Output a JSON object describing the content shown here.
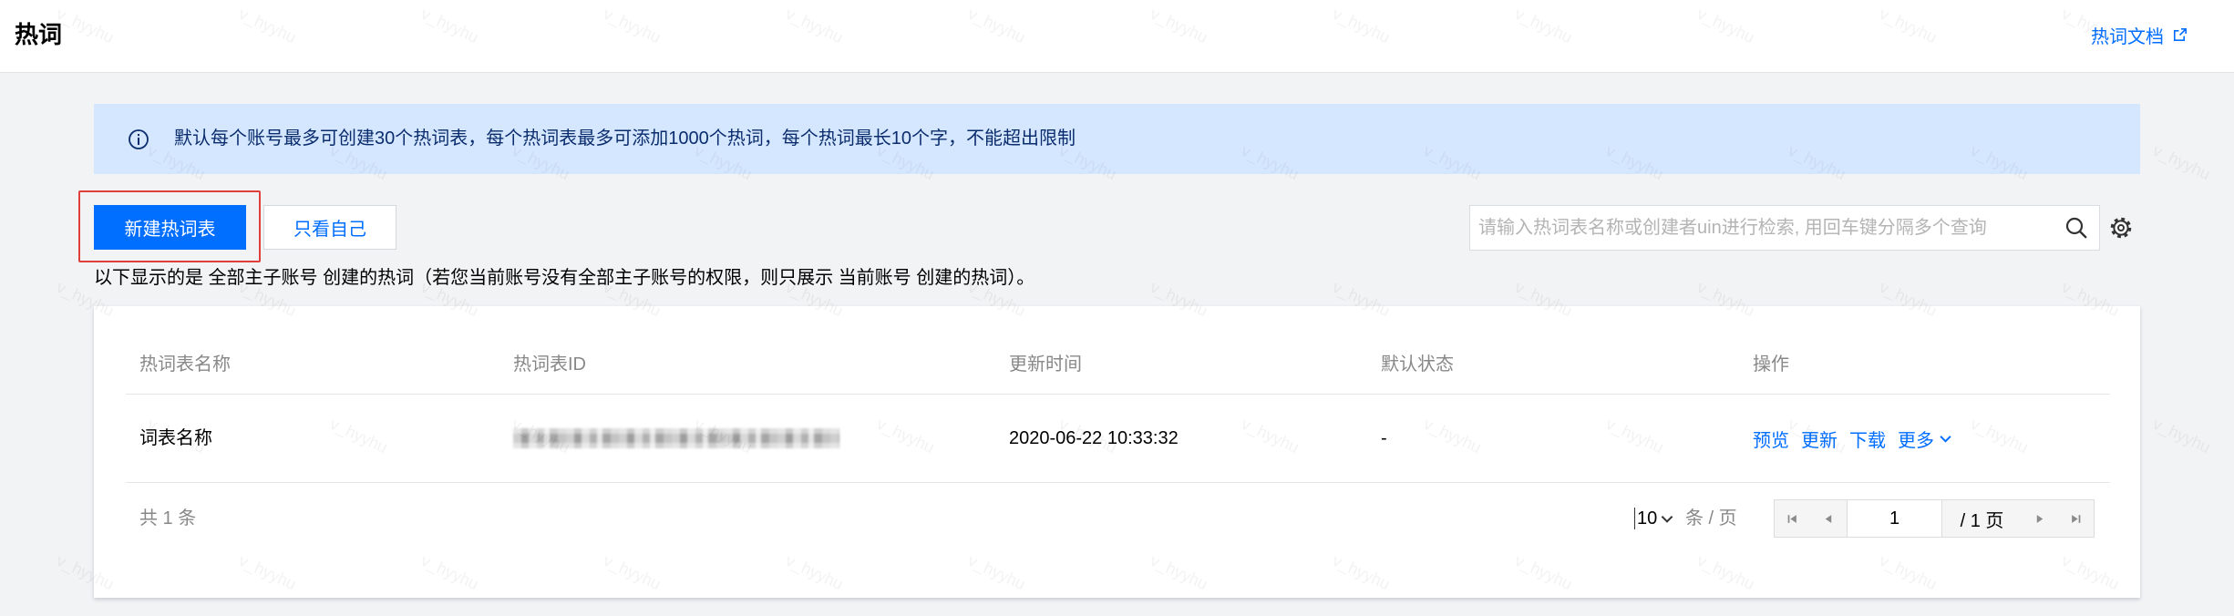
{
  "header": {
    "title": "热词",
    "doc_link_label": "热词文档",
    "doc_link_icon": "external-link-icon"
  },
  "notice": {
    "icon": "info-icon",
    "text": "默认每个账号最多可创建30个热词表，每个热词表最多可添加1000个热词，每个热词最长10个字，不能超出限制"
  },
  "toolbar": {
    "create_button_label": "新建热词表",
    "mine_only_button_label": "只看自己",
    "search": {
      "placeholder": "请输入热词表名称或创建者uin进行检索, 用回车键分隔多个查询",
      "icon": "search-icon"
    },
    "settings_icon": "gear-icon"
  },
  "scope_note": "以下显示的是 全部主子账号 创建的热词（若您当前账号没有全部主子账号的权限，则只展示 当前账号 创建的热词）。",
  "table": {
    "columns": [
      "热词表名称",
      "热词表ID",
      "更新时间",
      "默认状态",
      "操作"
    ],
    "rows": [
      {
        "name": "词表名称",
        "updated_at": "2020-06-22 10:33:32",
        "default_status": "-",
        "actions": [
          "预览",
          "更新",
          "下载",
          "更多"
        ],
        "more_icon": "chevron-down-icon"
      }
    ]
  },
  "pagination": {
    "total_label": "共 1 条",
    "page_size": "10",
    "page_size_unit": "条 / 页",
    "current_page": "1",
    "total_pages_label": "/ 1 页",
    "icons": [
      "first-page-icon",
      "prev-page-icon",
      "next-page-icon",
      "last-page-icon"
    ]
  },
  "watermark": "v_hyyhu",
  "colors": {
    "accent": "#006eff",
    "notice_background": "#d5e7ff",
    "notice_text": "#0b2d6e",
    "highlight_border": "#e0403b"
  }
}
